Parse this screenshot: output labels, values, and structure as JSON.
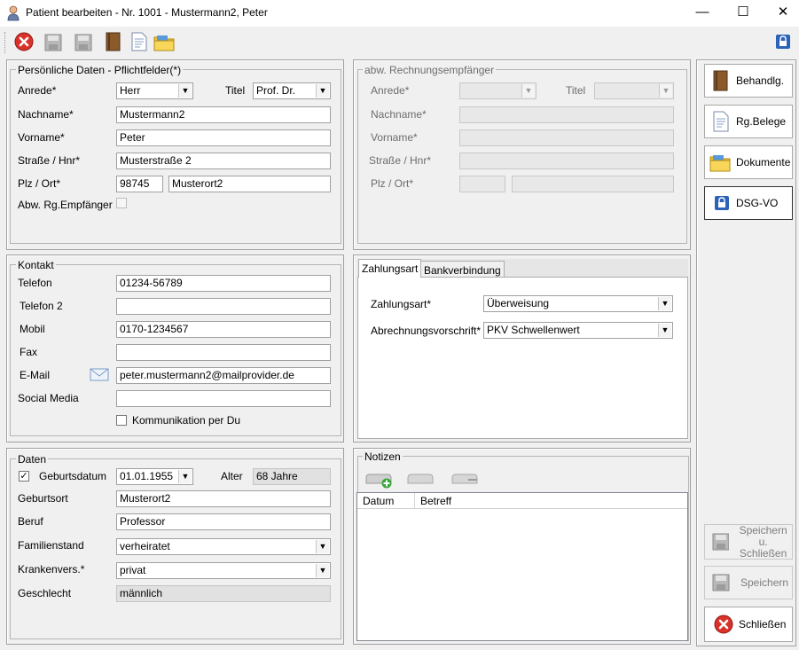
{
  "window": {
    "title": "Patient bearbeiten - Nr. 1001 - Mustermann2, Peter",
    "min": "—",
    "max": "☐",
    "close": "✕"
  },
  "personal": {
    "title": "Persönliche Daten - Pflichtfelder(*)",
    "anrede_label": "Anrede*",
    "anrede_value": "Herr",
    "titel_label": "Titel",
    "titel_value": "Prof. Dr.",
    "nachname_label": "Nachname*",
    "nachname_value": "Mustermann2",
    "vorname_label": "Vorname*",
    "vorname_value": "Peter",
    "strasse_label": "Straße / Hnr*",
    "strasse_value": "Musterstraße 2",
    "plz_label": "Plz / Ort*",
    "plz_value": "98745",
    "ort_value": "Musterort2",
    "abw_label": "Abw. Rg.Empfänger"
  },
  "billing": {
    "title": "abw. Rechnungsempfänger",
    "anrede_label": "Anrede*",
    "titel_label": "Titel",
    "nachname_label": "Nachname*",
    "vorname_label": "Vorname*",
    "strasse_label": "Straße / Hnr*",
    "plz_label": "Plz / Ort*"
  },
  "contact": {
    "title": "Kontakt",
    "telefon_label": "Telefon",
    "telefon_value": "01234-56789",
    "telefon2_label": "Telefon 2",
    "telefon2_value": "",
    "mobil_label": "Mobil",
    "mobil_value": "0170-1234567",
    "fax_label": "Fax",
    "fax_value": "",
    "email_label": "E-Mail",
    "email_value": "peter.mustermann2@mailprovider.de",
    "social_label": "Social Media",
    "social_value": "",
    "du_label": "Kommunikation per Du"
  },
  "payment": {
    "tab1": "Zahlungsart",
    "tab2": "Bankverbindung",
    "zahlungsart_label": "Zahlungsart*",
    "zahlungsart_value": "Überweisung",
    "abrechnung_label": "Abrechnungsvorschrift*",
    "abrechnung_value": "PKV Schwellenwert"
  },
  "daten": {
    "title": "Daten",
    "geburtsdatum_label": "Geburtsdatum",
    "geburtsdatum_value": "01.01.1955",
    "alter_label": "Alter",
    "alter_value": "68 Jahre",
    "geburtsort_label": "Geburtsort",
    "geburtsort_value": "Musterort2",
    "beruf_label": "Beruf",
    "beruf_value": "Professor",
    "familienstand_label": "Familienstand",
    "familienstand_value": "verheiratet",
    "krankenvers_label": "Krankenvers.*",
    "krankenvers_value": "privat",
    "geschlecht_label": "Geschlecht",
    "geschlecht_value": "männlich"
  },
  "notes": {
    "title": "Notizen",
    "col_datum": "Datum",
    "col_betreff": "Betreff"
  },
  "side": {
    "behandlg": "Behandlg.",
    "rgbelege": "Rg.Belege",
    "dokumente": "Dokumente",
    "dsgvo": "DSG-VO",
    "speichern_schliessen_1": "Speichern u.",
    "speichern_schliessen_2": "Schließen",
    "speichern": "Speichern",
    "schliessen": "Schließen"
  },
  "colors": {
    "close_red": "#d9322b",
    "folder_yellow": "#f2c230",
    "book_brown": "#8a5a2b",
    "lock_blue": "#2a63b8",
    "plus_green": "#3aa63a"
  }
}
